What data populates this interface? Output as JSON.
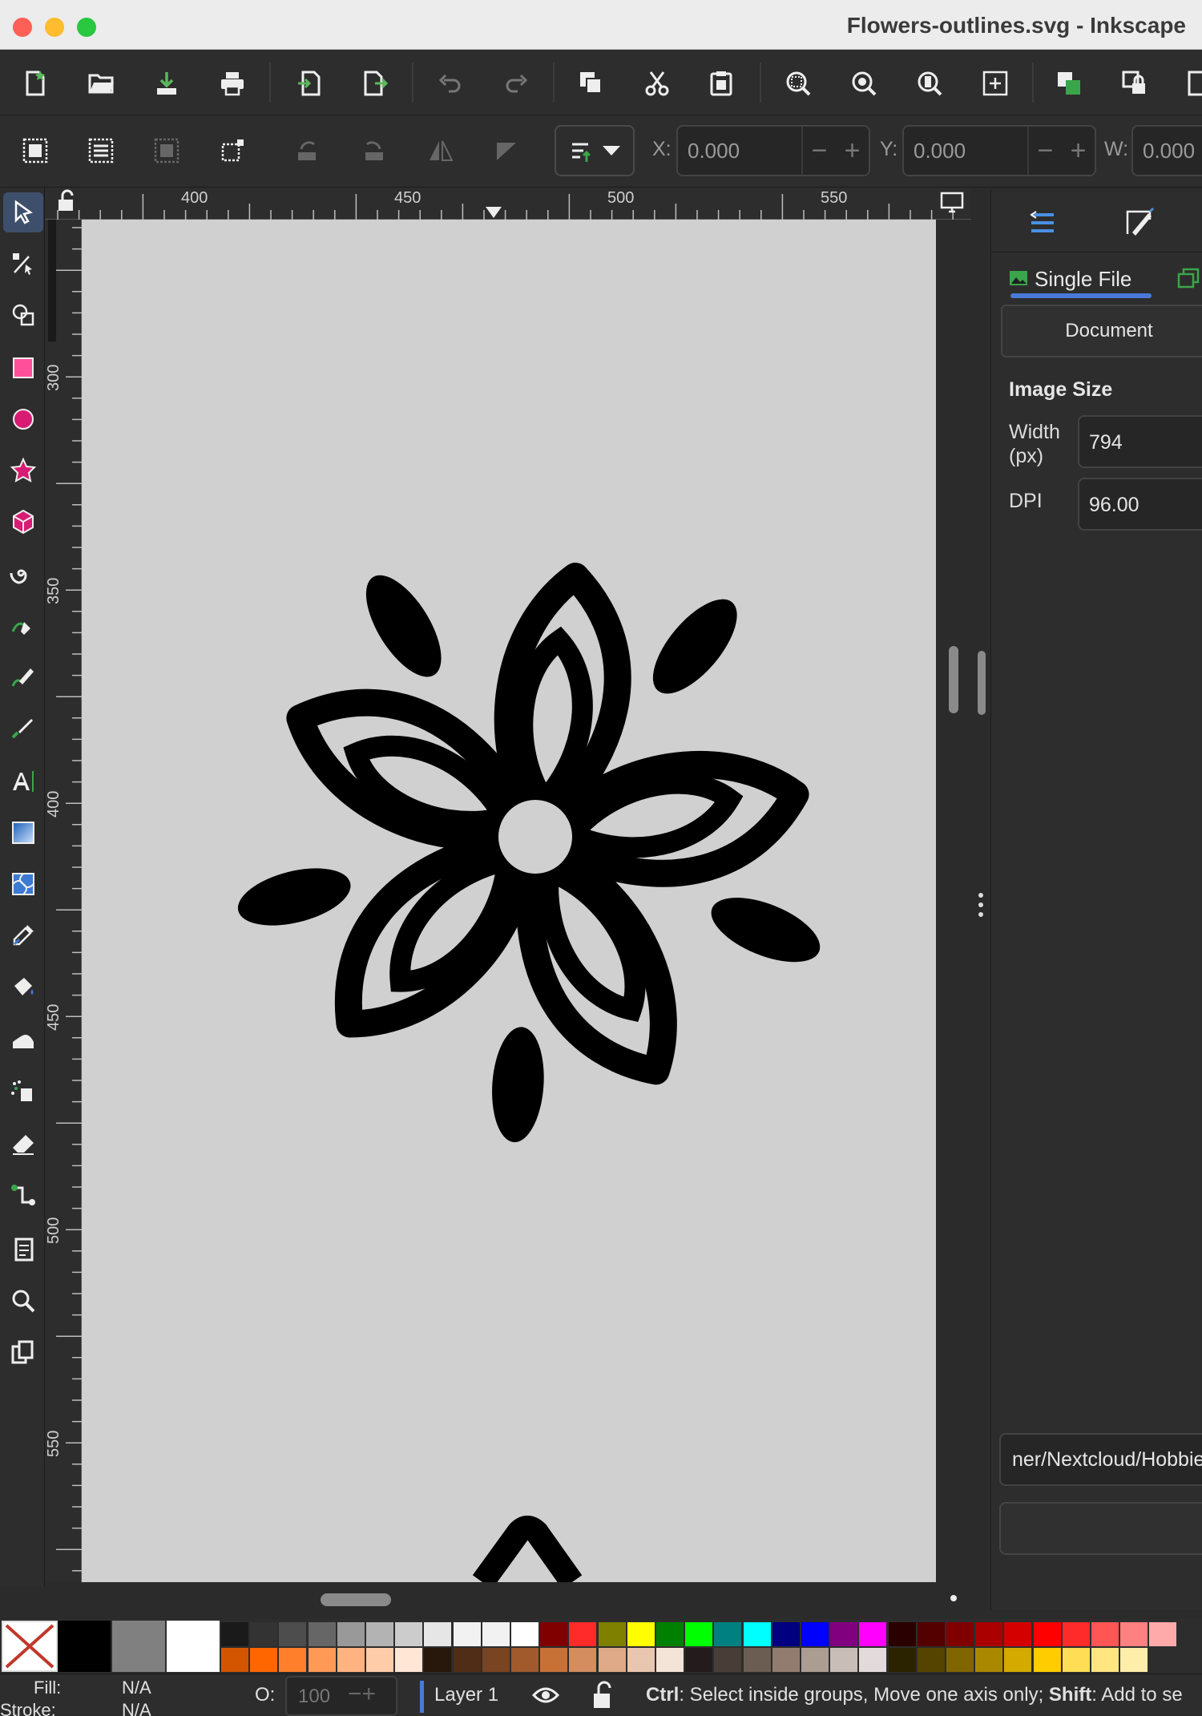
{
  "window": {
    "title": "Flowers-outlines.svg - Inkscape",
    "traffic_lights": [
      "#fe5f57",
      "#febc2e",
      "#28c840"
    ]
  },
  "command_bar": {
    "icons": [
      "new-document-icon",
      "open-icon",
      "save-icon",
      "print-icon",
      "import-icon",
      "export-icon",
      "undo-icon",
      "redo-icon",
      "duplicate-icon",
      "cut-icon",
      "paste-icon",
      "zoom-selection-icon",
      "zoom-drawing-icon",
      "zoom-page-icon",
      "zoom-center-icon",
      "raise-icon",
      "lock-icon",
      "more-icon"
    ]
  },
  "tool_controls": {
    "x_label": "X:",
    "x_value": "0.000",
    "y_label": "Y:",
    "y_value": "0.000",
    "w_label": "W:",
    "w_value": "0.000"
  },
  "toolbox": {
    "tools": [
      "selector",
      "node",
      "shape-builder",
      "rectangle",
      "ellipse",
      "star",
      "3d-box",
      "spiral",
      "pen",
      "pencil",
      "calligraphy",
      "text",
      "gradient",
      "mesh",
      "dropper",
      "paint-bucket",
      "tweak",
      "spray",
      "eraser",
      "connector",
      "pages",
      "zoom",
      "measure"
    ]
  },
  "rulers": {
    "horizontal_labels": [
      "400",
      "450",
      "500",
      "550"
    ],
    "vertical_labels": [
      "300",
      "350",
      "400",
      "450",
      "500",
      "550"
    ]
  },
  "dock": {
    "tab_single": "Single File",
    "document_button": "Document",
    "image_size_heading": "Image Size",
    "width_label": "Width (px)",
    "width_value": "794",
    "dpi_label": "DPI",
    "dpi_value": "96.00",
    "path_value": "ner/Nextcloud/Hobbie"
  },
  "palette": {
    "swatches": [
      "#000000",
      "#808080",
      "#ffffff"
    ],
    "top_row": [
      "#1a1a1a",
      "#333333",
      "#4d4d4d",
      "#666666",
      "#999999",
      "#b3b3b3",
      "#cccccc",
      "#e6e6e6",
      "#f2f2f2",
      "#f2f2f2",
      "#ffffff",
      "#800000",
      "#ff2a2a",
      "#808000",
      "#ffff00",
      "#008000",
      "#00ff00",
      "#008080",
      "#00ffff",
      "#000080",
      "#0000ff",
      "#800080",
      "#ff00ff",
      "#2b0000",
      "#550000",
      "#800000",
      "#aa0000",
      "#d40000",
      "#ff0000",
      "#ff2a2a",
      "#ff5555",
      "#ff8080",
      "#ffaaaa"
    ],
    "bottom_row": [
      "#d45500",
      "#ff6600",
      "#ff7f2a",
      "#ff9955",
      "#ffb380",
      "#ffccaa",
      "#ffe6d5",
      "#28170b",
      "#502d16",
      "#784421",
      "#a05a2c",
      "#c87137",
      "#d38d5f",
      "#deaa87",
      "#e9c6af",
      "#f4e3d7",
      "#241c1c",
      "#483e37",
      "#6c5d53",
      "#917c6f",
      "#ac9d93",
      "#c8beb7",
      "#e3dbdb",
      "#2b2200",
      "#554400",
      "#806600",
      "#aa8800",
      "#d4aa00",
      "#ffcc00",
      "#ffdd55",
      "#ffe680",
      "#ffeeaa"
    ]
  },
  "status": {
    "fill_label": "Fill:",
    "fill_value": "N/A",
    "stroke_label": "Stroke:",
    "stroke_value": "N/A",
    "opacity_label": "O:",
    "opacity_value": "100",
    "layer_name": "Layer 1",
    "hint_ctrl": "Ctrl",
    "hint_ctrl_text": ": Select inside groups, Move one axis only; ",
    "hint_shift": "Shift",
    "hint_shift_text": ": Add to se"
  }
}
